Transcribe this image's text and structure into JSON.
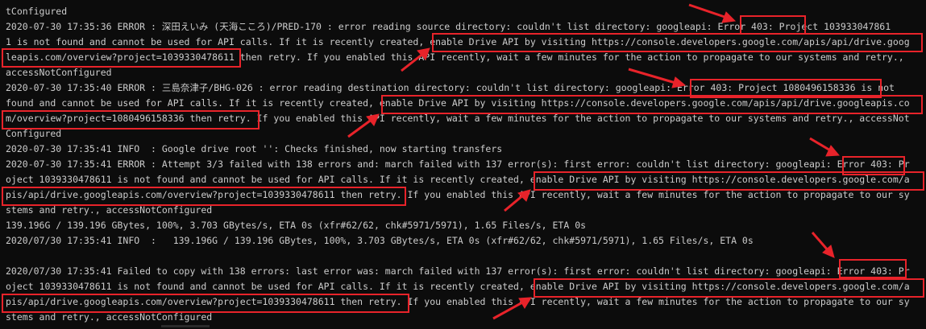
{
  "terminal": {
    "lines": [
      "tConfigured",
      "2020-07-30 17:35:36 ERROR : 深田えいみ (天海こころ)/PRED-170 : error reading source directory: couldn't list directory: googleapi: Error 403: Project 103933047861",
      "1 is not found and cannot be used for API calls. If it is recently created, enable Drive API by visiting https://console.developers.google.com/apis/api/drive.goog",
      "leapis.com/overview?project=1039330478611 then retry. If you enabled this API recently, wait a few minutes for the action to propagate to our systems and retry.,",
      "accessNotConfigured",
      "2020-07-30 17:35:40 ERROR : 三島奈津子/BHG-026 : error reading destination directory: couldn't list directory: googleapi: Error 403: Project 1080496158336 is not",
      "found and cannot be used for API calls. If it is recently created, enable Drive API by visiting https://console.developers.google.com/apis/api/drive.googleapis.co",
      "m/overview?project=1080496158336 then retry. If you enabled this API recently, wait a few minutes for the action to propagate to our systems and retry., accessNot",
      "Configured",
      "2020-07-30 17:35:41 INFO  : Google drive root '': Checks finished, now starting transfers",
      "2020-07-30 17:35:41 ERROR : Attempt 3/3 failed with 138 errors and: march failed with 137 error(s): first error: couldn't list directory: googleapi: Error 403: Pr",
      "oject 1039330478611 is not found and cannot be used for API calls. If it is recently created, enable Drive API by visiting https://console.developers.google.com/a",
      "pis/api/drive.googleapis.com/overview?project=1039330478611 then retry. If you enabled this API recently, wait a few minutes for the action to propagate to our sy",
      "stems and retry., accessNotConfigured",
      "139.196G / 139.196 GBytes, 100%, 3.703 GBytes/s, ETA 0s (xfr#62/62, chk#5971/5971), 1.65 Files/s, ETA 0s",
      "2020/07/30 17:35:41 INFO  :   139.196G / 139.196 GBytes, 100%, 3.703 GBytes/s, ETA 0s (xfr#62/62, chk#5971/5971), 1.65 Files/s, ETA 0s",
      "",
      "2020/07/30 17:35:41 Failed to copy with 138 errors: last error was: march failed with 137 error(s): first error: couldn't list directory: googleapi: Error 403: Pr",
      "oject 1039330478611 is not found and cannot be used for API calls. If it is recently created, enable Drive API by visiting https://console.developers.google.com/a",
      "pis/api/drive.googleapis.com/overview?project=1039330478611 then retry. If you enabled this API recently, wait a few minutes for the action to propagate to our sy",
      "stems and retry., accessNotConfigured"
    ]
  },
  "colors": {
    "background": "#0c0c0c",
    "text": "#cccccc",
    "annotation": "#e8232a"
  }
}
